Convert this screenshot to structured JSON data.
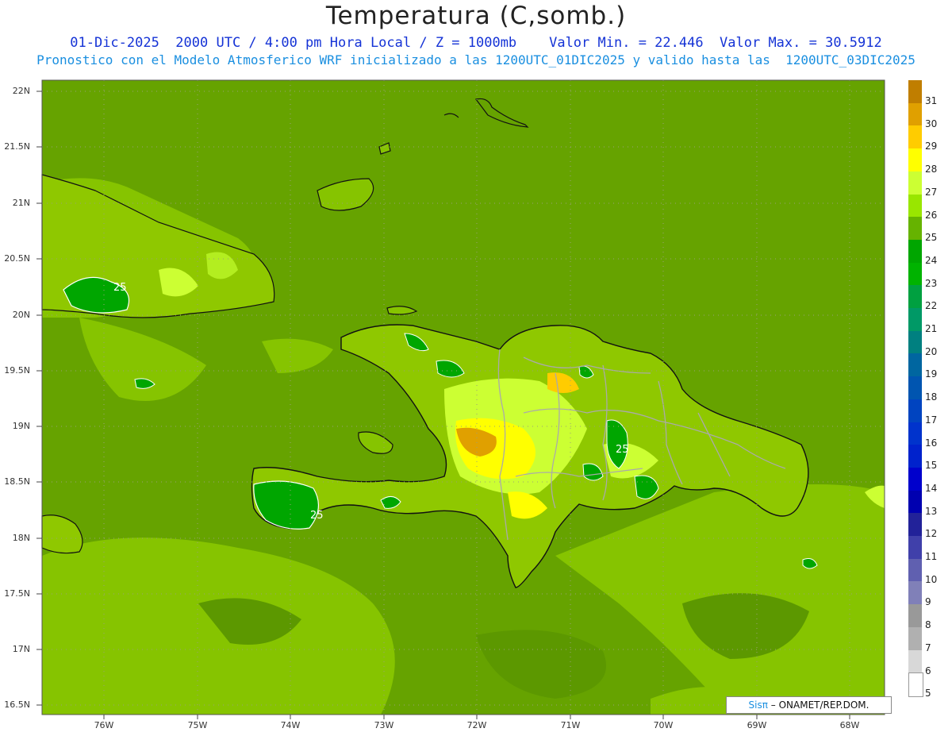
{
  "header": {
    "title": "Temperatura (C,somb.)",
    "line1": "01-Dic-2025  2000 UTC / 4:00 pm Hora Local / Z = 1000mb    Valor Min. = 22.446  Valor Max. = 30.5912",
    "line2": "Pronostico con el Modelo Atmosferico WRF inicializado a las 1200UTC_01DIC2025 y valido hasta las  1200UTC_03DIC2025"
  },
  "axes": {
    "lat_labels": [
      "22N",
      "21.5N",
      "21N",
      "20.5N",
      "20N",
      "19.5N",
      "19N",
      "18.5N",
      "18N",
      "17.5N",
      "17N",
      "16.5N"
    ],
    "lon_labels": [
      "76W",
      "75W",
      "74W",
      "73W",
      "72W",
      "71W",
      "70W",
      "69W",
      "68W"
    ]
  },
  "colorbar": {
    "labels": [
      "31",
      "30",
      "29",
      "28",
      "27",
      "26",
      "25",
      "24",
      "23",
      "22",
      "21",
      "20",
      "19",
      "18",
      "17",
      "16",
      "15",
      "14",
      "13",
      "12",
      "11",
      "10",
      "9",
      "8",
      "7",
      "6",
      "5"
    ],
    "colors": [
      "#c07e00",
      "#e0a000",
      "#ffcc00",
      "#ffff00",
      "#ccff33",
      "#99e600",
      "#66b300",
      "#00a600",
      "#00b300",
      "#00a040",
      "#009966",
      "#008080",
      "#0066a0",
      "#0055b0",
      "#0044c0",
      "#0033cc",
      "#0022cc",
      "#0000cc",
      "#0000b0",
      "#222299",
      "#4040aa",
      "#6060b0",
      "#8080b8",
      "#999999",
      "#b0b0b0",
      "#d8d8d8",
      "#ffffff"
    ]
  },
  "contour_labels": [
    "25",
    "25",
    "25"
  ],
  "credit": {
    "sis": "Sisπ",
    "rest": " – ONAMET/REP.DOM."
  }
}
